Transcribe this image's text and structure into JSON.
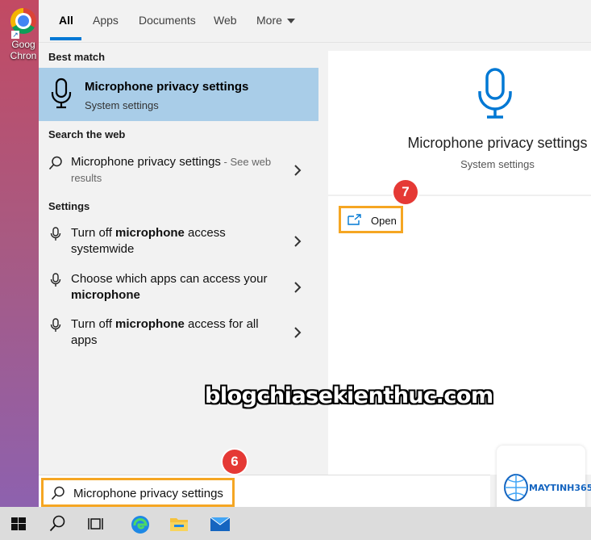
{
  "desktop": {
    "shortcut_label": "Goog\nChron"
  },
  "tabs": [
    {
      "label": "All"
    },
    {
      "label": "Apps"
    },
    {
      "label": "Documents"
    },
    {
      "label": "Web"
    },
    {
      "label": "More"
    }
  ],
  "results": {
    "best_match_heading": "Best match",
    "best_match": {
      "title": "Microphone privacy settings",
      "subtitle": "System settings"
    },
    "search_web_heading": "Search the web",
    "web_result": {
      "text": "Microphone privacy settings",
      "hint": " - See web results"
    },
    "settings_heading": "Settings",
    "settings_items": [
      {
        "pre": "Turn off ",
        "bold": "microphone",
        "post": " access systemwide"
      },
      {
        "pre": "Choose which apps can access your ",
        "bold": "microphone",
        "post": ""
      },
      {
        "pre": "Turn off ",
        "bold": "microphone",
        "post": " access for all apps"
      }
    ]
  },
  "preview": {
    "title": "Microphone privacy settings",
    "subtitle": "System settings",
    "open_label": "Open"
  },
  "annotations": {
    "step_open": "7",
    "step_search": "6"
  },
  "watermark": "blogchiasekienthuc.com",
  "logo": {
    "text": "MAYTINH365"
  },
  "search": {
    "value": "Microphone privacy settings"
  },
  "taskbar": {
    "icons": [
      "windows-start-icon",
      "search-icon",
      "task-view-icon",
      "edge-icon",
      "file-explorer-icon",
      "mail-icon"
    ]
  },
  "colors": {
    "highlight": "#a9cde8",
    "accent": "#0078d4",
    "callout_border": "#f5a623",
    "badge": "#e53935"
  }
}
